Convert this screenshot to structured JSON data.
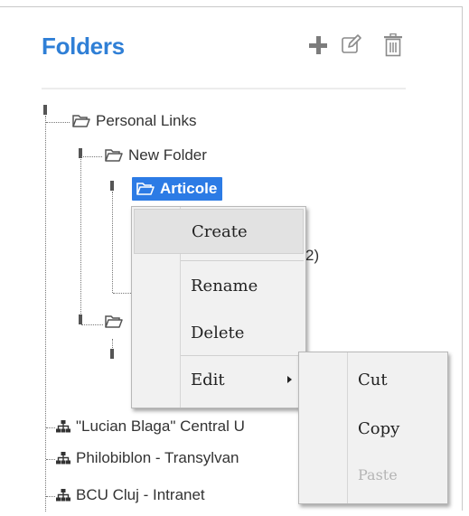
{
  "panel": {
    "title": "Folders"
  },
  "tree": {
    "personal_links": "Personal Links",
    "new_folder": "New Folder",
    "articole": "Articole",
    "hidden_count_fragment": "2)",
    "lucian_blaga": "\"Lucian Blaga\" Central U",
    "philobiblon": "Philobiblon - Transylvan",
    "bcu_cluj": "BCU Cluj - Intranet"
  },
  "context_menu": {
    "create": "Create",
    "rename": "Rename",
    "delete": "Delete",
    "edit": "Edit"
  },
  "submenu": {
    "cut": "Cut",
    "copy": "Copy",
    "paste": "Paste"
  },
  "colors": {
    "accent": "#2f7fd6",
    "selected_bg": "#2c7be5"
  }
}
